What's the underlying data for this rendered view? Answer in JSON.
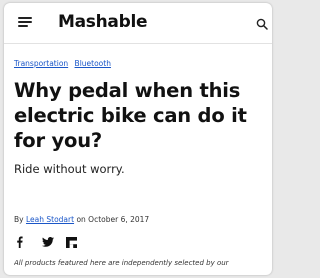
{
  "header": {
    "logo": "Mashable",
    "menu_icon": "hamburger-menu-icon",
    "search_icon": "search-icon"
  },
  "article": {
    "tags": [
      "Transportation",
      "Bluetooth"
    ],
    "headline": "Why pedal when this electric bike can do it for you?",
    "subheadline": "Ride without worry.",
    "byline_prefix": "By",
    "author": "Leah Stodart",
    "date": "on October 6, 2017",
    "share_icons": [
      "facebook-icon",
      "twitter-icon",
      "flipboard-icon"
    ],
    "disclaimer": "All products featured here are independently selected by our"
  },
  "colors": {
    "link": "#1a56c8",
    "text": "#111111"
  }
}
